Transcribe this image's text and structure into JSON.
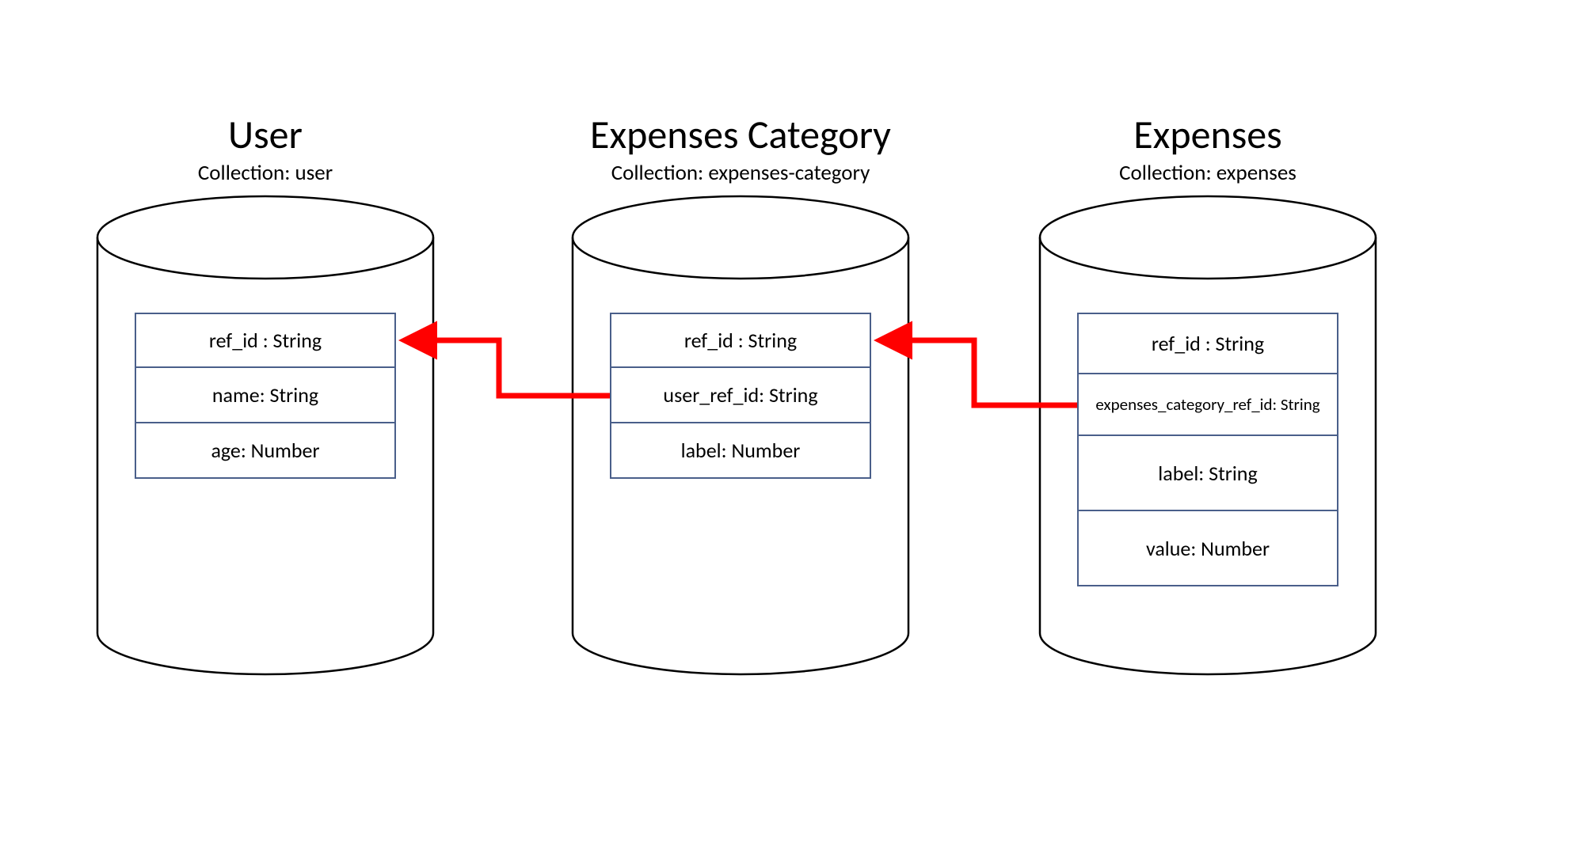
{
  "entities": [
    {
      "key": "user",
      "title": "User",
      "subtitle": "Collection: user",
      "fields": [
        "ref_id : String",
        "name: String",
        "age: Number"
      ]
    },
    {
      "key": "expenses_category",
      "title": "Expenses Category",
      "subtitle": "Collection: expenses-category",
      "fields": [
        "ref_id : String",
        "user_ref_id: String",
        "label: Number"
      ]
    },
    {
      "key": "expenses",
      "title": "Expenses",
      "subtitle": "Collection: expenses",
      "fields": [
        "ref_id : String",
        "expenses_category_ref_id: String",
        "label: String",
        "value: Number"
      ]
    }
  ]
}
